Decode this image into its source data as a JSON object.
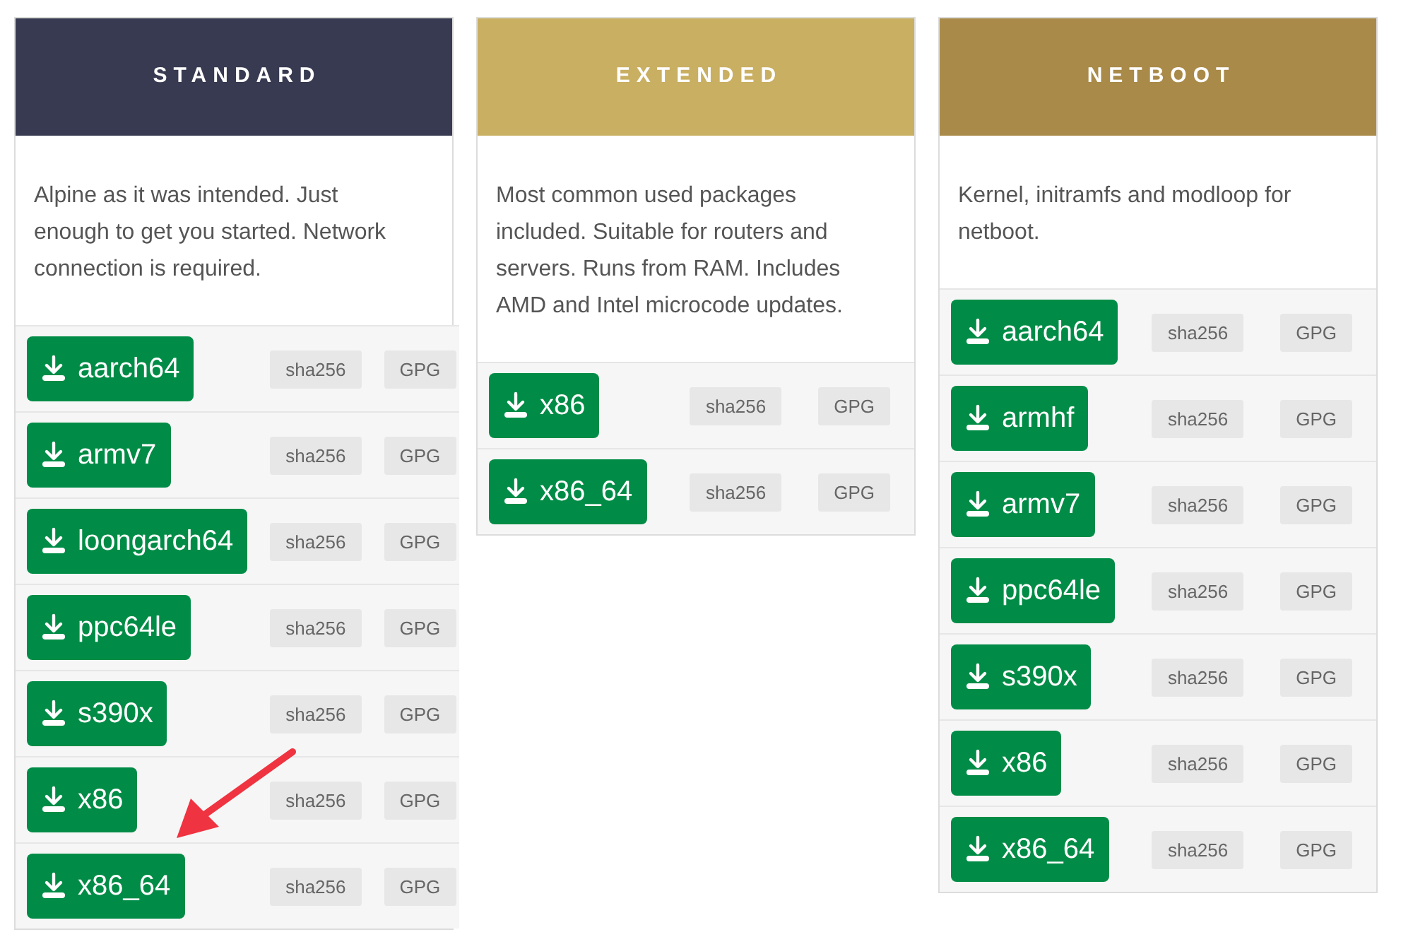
{
  "cards": [
    {
      "title": "STANDARD",
      "color": "#373a50",
      "description": "Alpine as it was intended. Just enough to get you started. Network connection is required.",
      "downloads": [
        {
          "arch": "aarch64",
          "checksum": "sha256",
          "signature": "GPG"
        },
        {
          "arch": "armv7",
          "checksum": "sha256",
          "signature": "GPG"
        },
        {
          "arch": "loongarch64",
          "checksum": "sha256",
          "signature": "GPG"
        },
        {
          "arch": "ppc64le",
          "checksum": "sha256",
          "signature": "GPG"
        },
        {
          "arch": "s390x",
          "checksum": "sha256",
          "signature": "GPG"
        },
        {
          "arch": "x86",
          "checksum": "sha256",
          "signature": "GPG"
        },
        {
          "arch": "x86_64",
          "checksum": "sha256",
          "signature": "GPG"
        }
      ]
    },
    {
      "title": "EXTENDED",
      "color": "#c9af62",
      "description": "Most common used packages included. Suitable for routers and servers. Runs from RAM. Includes AMD and Intel microcode updates.",
      "downloads": [
        {
          "arch": "x86",
          "checksum": "sha256",
          "signature": "GPG"
        },
        {
          "arch": "x86_64",
          "checksum": "sha256",
          "signature": "GPG"
        }
      ]
    },
    {
      "title": "NETBOOT",
      "color": "#a98a48",
      "description": "Kernel, initramfs and modloop for netboot.",
      "downloads": [
        {
          "arch": "aarch64",
          "checksum": "sha256",
          "signature": "GPG"
        },
        {
          "arch": "armhf",
          "checksum": "sha256",
          "signature": "GPG"
        },
        {
          "arch": "armv7",
          "checksum": "sha256",
          "signature": "GPG"
        },
        {
          "arch": "ppc64le",
          "checksum": "sha256",
          "signature": "GPG"
        },
        {
          "arch": "s390x",
          "checksum": "sha256",
          "signature": "GPG"
        },
        {
          "arch": "x86",
          "checksum": "sha256",
          "signature": "GPG"
        },
        {
          "arch": "x86_64",
          "checksum": "sha256",
          "signature": "GPG"
        }
      ]
    }
  ]
}
